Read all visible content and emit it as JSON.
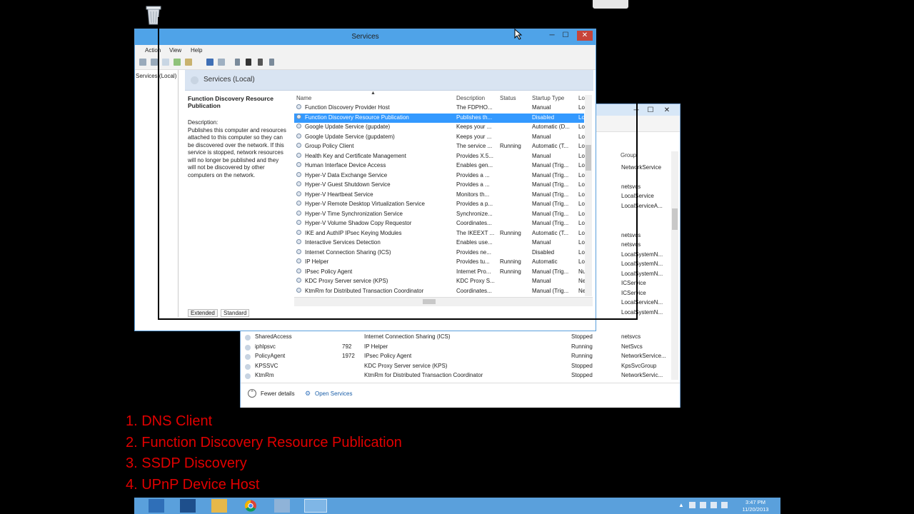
{
  "services_window": {
    "title": "Services",
    "menu": [
      "Action",
      "View",
      "Help"
    ],
    "tree_item": "Services (Local)",
    "header": "Services (Local)",
    "selected_name": "Function Discovery Resource Publication",
    "description_label": "Description:",
    "description_text": "Publishes this computer and resources attached to this computer so they can be discovered over the network. If this service is stopped, network resources will no longer be published and they will not be discovered by other computers on the network.",
    "columns": [
      "Name",
      "Description",
      "Status",
      "Startup Type",
      "Lo"
    ],
    "rows": [
      {
        "name": "Function Discovery Provider Host",
        "desc": "The FDPHO...",
        "status": "",
        "startup": "Manual",
        "log": "Lo"
      },
      {
        "name": "Function Discovery Resource Publication",
        "desc": "Publishes th...",
        "status": "",
        "startup": "Disabled",
        "log": "Lo"
      },
      {
        "name": "Google Update Service (gupdate)",
        "desc": "Keeps your ...",
        "status": "",
        "startup": "Automatic (D...",
        "log": "Lo"
      },
      {
        "name": "Google Update Service (gupdatem)",
        "desc": "Keeps your ...",
        "status": "",
        "startup": "Manual",
        "log": "Lo"
      },
      {
        "name": "Group Policy Client",
        "desc": "The service ...",
        "status": "Running",
        "startup": "Automatic (T...",
        "log": "Lo"
      },
      {
        "name": "Health Key and Certificate Management",
        "desc": "Provides X.5...",
        "status": "",
        "startup": "Manual",
        "log": "Lo"
      },
      {
        "name": "Human Interface Device Access",
        "desc": "Enables gen...",
        "status": "",
        "startup": "Manual (Trig...",
        "log": "Lo"
      },
      {
        "name": "Hyper-V Data Exchange Service",
        "desc": "Provides a ...",
        "status": "",
        "startup": "Manual (Trig...",
        "log": "Lo"
      },
      {
        "name": "Hyper-V Guest Shutdown Service",
        "desc": "Provides a ...",
        "status": "",
        "startup": "Manual (Trig...",
        "log": "Lo"
      },
      {
        "name": "Hyper-V Heartbeat Service",
        "desc": "Monitors th...",
        "status": "",
        "startup": "Manual (Trig...",
        "log": "Lo"
      },
      {
        "name": "Hyper-V Remote Desktop Virtualization Service",
        "desc": "Provides a p...",
        "status": "",
        "startup": "Manual (Trig...",
        "log": "Lo"
      },
      {
        "name": "Hyper-V Time Synchronization Service",
        "desc": "Synchronize...",
        "status": "",
        "startup": "Manual (Trig...",
        "log": "Lo"
      },
      {
        "name": "Hyper-V Volume Shadow Copy Requestor",
        "desc": "Coordinates...",
        "status": "",
        "startup": "Manual (Trig...",
        "log": "Lo"
      },
      {
        "name": "IKE and AuthIP IPsec Keying Modules",
        "desc": "The IKEEXT ...",
        "status": "Running",
        "startup": "Automatic (T...",
        "log": "Lo"
      },
      {
        "name": "Interactive Services Detection",
        "desc": "Enables use...",
        "status": "",
        "startup": "Manual",
        "log": "Lo"
      },
      {
        "name": "Internet Connection Sharing (ICS)",
        "desc": "Provides ne...",
        "status": "",
        "startup": "Disabled",
        "log": "Lo"
      },
      {
        "name": "IP Helper",
        "desc": "Provides tu...",
        "status": "Running",
        "startup": "Automatic",
        "log": "Lo"
      },
      {
        "name": "IPsec Policy Agent",
        "desc": "Internet Pro...",
        "status": "Running",
        "startup": "Manual (Trig...",
        "log": "Nu"
      },
      {
        "name": "KDC Proxy Server service (KPS)",
        "desc": "KDC Proxy S...",
        "status": "",
        "startup": "Manual",
        "log": "Ne"
      },
      {
        "name": "KtmRm for Distributed Transaction Coordinator",
        "desc": "Coordinates...",
        "status": "",
        "startup": "Manual (Trig...",
        "log": "Ne"
      }
    ],
    "tabs": [
      "Extended",
      "Standard"
    ]
  },
  "task_manager": {
    "group_header": "Group",
    "side_groups": [
      "NetworkService",
      "netsvcs",
      "LocalService",
      "LocalServiceA...",
      "netsvcs",
      "netsvcs",
      "LocalSystemN...",
      "LocalSystemN...",
      "LocalSystemN...",
      "ICService",
      "ICService",
      "LocalServiceN...",
      "LocalSystemN..."
    ],
    "rows": [
      {
        "name": "SharedAccess",
        "pid": "",
        "desc": "Internet Connection Sharing (ICS)",
        "status": "Stopped",
        "group": "netsvcs"
      },
      {
        "name": "iphlpsvc",
        "pid": "792",
        "desc": "IP Helper",
        "status": "Running",
        "group": "NetSvcs"
      },
      {
        "name": "PolicyAgent",
        "pid": "1972",
        "desc": "IPsec Policy Agent",
        "status": "Running",
        "group": "NetworkService..."
      },
      {
        "name": "KPSSVC",
        "pid": "",
        "desc": "KDC Proxy Server service (KPS)",
        "status": "Stopped",
        "group": "KpsSvcGroup"
      },
      {
        "name": "KtmRm",
        "pid": "",
        "desc": "KtmRm for Distributed Transaction Coordinator",
        "status": "Stopped",
        "group": "NetworkServic..."
      }
    ],
    "fewer_details": "Fewer details",
    "open_services": "Open Services"
  },
  "taskbar": {
    "time": "3:47 PM",
    "date": "11/20/2013"
  },
  "notes": [
    "1. DNS Client",
    "2. Function Discovery Resource Publication",
    "3. SSDP Discovery",
    "4. UPnP Device Host"
  ],
  "colors": {
    "title_bar": "#4fa3e8",
    "selection": "#3399ff",
    "note_text": "#e00000",
    "taskbar": "#5aa0dc"
  }
}
